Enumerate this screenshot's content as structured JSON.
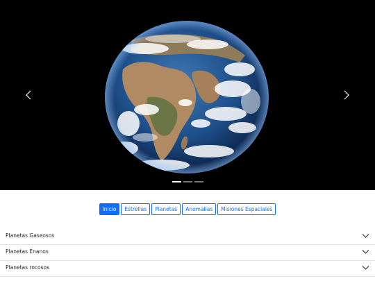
{
  "carousel": {
    "prev_icon": "chevron-left-icon",
    "next_icon": "chevron-right-icon",
    "slide_count": 3,
    "active_slide": 0
  },
  "tabs": [
    {
      "label": "Inicio",
      "active": true
    },
    {
      "label": "Estrellas",
      "active": false
    },
    {
      "label": "Planetas",
      "active": false
    },
    {
      "label": "Anomalias",
      "active": false
    },
    {
      "label": "Misiones Espaciales",
      "active": false
    }
  ],
  "accordion": [
    {
      "label": "Planetas Gaseosos",
      "icon": "chevron-down-icon"
    },
    {
      "label": "Planetas Enanos",
      "icon": "chevron-down-icon"
    },
    {
      "label": "Planetas rocosos",
      "icon": "chevron-down-icon"
    }
  ],
  "colors": {
    "primary": "#0d6efd",
    "carousel_bg": "#000000"
  }
}
